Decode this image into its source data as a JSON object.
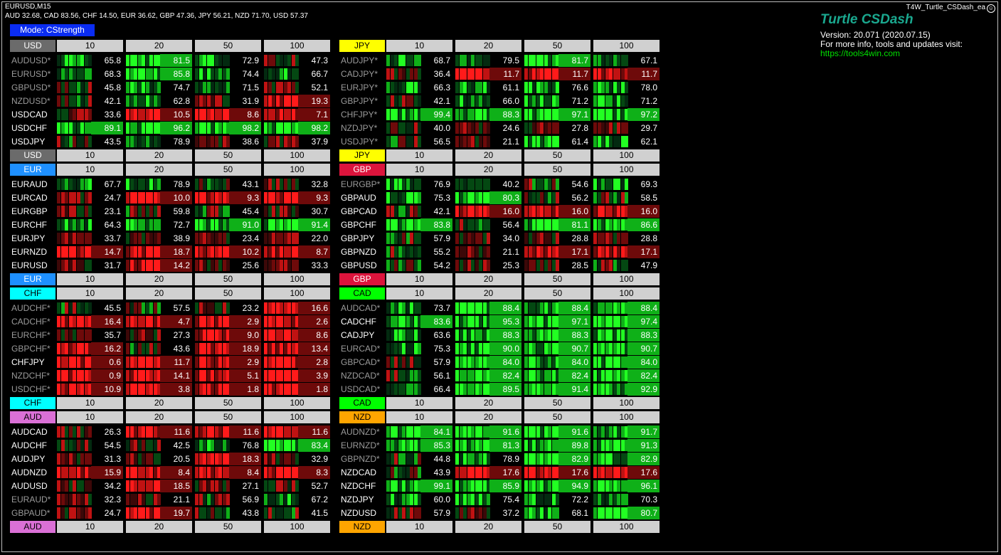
{
  "window": {
    "symbol_line": "EURUSD,M15",
    "strength_line": "AUD 32.68, CAD 83.56, CHF 14.50, EUR 36.62, GBP 47.36, JPY 56.21, NZD 71.70, USD 57.37",
    "ea_name": "T4W_Turtle_CSDash_ea"
  },
  "mode_button": {
    "label": "Mode: CStrength"
  },
  "brand": {
    "title": "Turtle CSDash",
    "version": "Version: 20.071 (2020.07.15)",
    "info": "For more info, tools and updates visit:",
    "link": "https://tools4win.com"
  },
  "colors": {
    "USD": "#6b6b6b",
    "EUR": "#1e90ff",
    "CHF": "#00ffff",
    "AUD": "#da70d6",
    "JPY": "#ffff00",
    "GBP": "#dc143c",
    "CAD": "#00ff00",
    "NZD": "#ffa500",
    "inactive_pair": "#9a9a9a",
    "active_pair": "#ffffff",
    "bright_green": "#22ff22",
    "green": "#0fb018",
    "dark_green": "#044812",
    "deepest_green": "#032a10",
    "bright_red": "#ff1a1a",
    "red": "#c01212",
    "dark_red": "#6e0a0a",
    "deepest_red": "#3c0808"
  },
  "timeframes": [
    "10",
    "20",
    "50",
    "100"
  ],
  "groups": [
    {
      "currency": "USD",
      "rows": [
        {
          "pair": "AUDUSD*",
          "values": [
            "65.8",
            "81.5",
            "72.9",
            "47.3"
          ]
        },
        {
          "pair": "EURUSD*",
          "values": [
            "68.3",
            "85.8",
            "74.4",
            "66.7"
          ]
        },
        {
          "pair": "GBPUSD*",
          "values": [
            "45.8",
            "74.7",
            "71.5",
            "52.1"
          ]
        },
        {
          "pair": "NZDUSD*",
          "values": [
            "42.1",
            "62.8",
            "31.9",
            "19.3"
          ]
        },
        {
          "pair": "USDCAD",
          "values": [
            "33.6",
            "10.5",
            "8.6",
            "7.1"
          ]
        },
        {
          "pair": "USDCHF",
          "values": [
            "89.1",
            "96.2",
            "98.2",
            "98.2"
          ]
        },
        {
          "pair": "USDJPY",
          "values": [
            "43.5",
            "78.9",
            "38.6",
            "37.9"
          ]
        }
      ]
    },
    {
      "currency": "JPY",
      "rows": [
        {
          "pair": "AUDJPY*",
          "values": [
            "68.7",
            "79.5",
            "81.7",
            "67.1"
          ]
        },
        {
          "pair": "CADJPY*",
          "values": [
            "36.4",
            "11.7",
            "11.7",
            "11.7"
          ]
        },
        {
          "pair": "EURJPY*",
          "values": [
            "66.3",
            "61.1",
            "76.6",
            "78.0"
          ]
        },
        {
          "pair": "GBPJPY*",
          "values": [
            "42.1",
            "66.0",
            "71.2",
            "71.2"
          ]
        },
        {
          "pair": "CHFJPY*",
          "values": [
            "99.4",
            "88.3",
            "97.1",
            "97.2"
          ]
        },
        {
          "pair": "NZDJPY*",
          "values": [
            "40.0",
            "24.6",
            "27.8",
            "29.7"
          ]
        },
        {
          "pair": "USDJPY*",
          "values": [
            "56.5",
            "21.1",
            "61.4",
            "62.1"
          ]
        }
      ]
    },
    {
      "currency": "EUR",
      "rows": [
        {
          "pair": "EURAUD",
          "values": [
            "67.7",
            "78.9",
            "43.1",
            "32.8"
          ]
        },
        {
          "pair": "EURCAD",
          "values": [
            "24.7",
            "10.0",
            "9.3",
            "9.3"
          ]
        },
        {
          "pair": "EURGBP",
          "values": [
            "23.1",
            "59.8",
            "45.4",
            "30.7"
          ]
        },
        {
          "pair": "EURCHF",
          "values": [
            "64.3",
            "72.7",
            "91.0",
            "91.4"
          ]
        },
        {
          "pair": "EURJPY",
          "values": [
            "33.7",
            "38.9",
            "23.4",
            "22.0"
          ]
        },
        {
          "pair": "EURNZD",
          "values": [
            "14.7",
            "18.7",
            "10.2",
            "8.7"
          ]
        },
        {
          "pair": "EURUSD",
          "values": [
            "31.7",
            "14.2",
            "25.6",
            "33.3"
          ]
        }
      ]
    },
    {
      "currency": "GBP",
      "rows": [
        {
          "pair": "EURGBP*",
          "values": [
            "76.9",
            "40.2",
            "54.6",
            "69.3"
          ]
        },
        {
          "pair": "GBPAUD",
          "values": [
            "75.3",
            "80.3",
            "56.2",
            "58.5"
          ]
        },
        {
          "pair": "GBPCAD",
          "values": [
            "42.1",
            "16.0",
            "16.0",
            "16.0"
          ]
        },
        {
          "pair": "GBPCHF",
          "values": [
            "83.8",
            "56.4",
            "81.1",
            "86.6"
          ]
        },
        {
          "pair": "GBPJPY",
          "values": [
            "57.9",
            "34.0",
            "28.8",
            "28.8"
          ]
        },
        {
          "pair": "GBPNZD",
          "values": [
            "55.2",
            "21.1",
            "17.1",
            "17.1"
          ]
        },
        {
          "pair": "GBPUSD",
          "values": [
            "54.2",
            "25.3",
            "28.5",
            "47.9"
          ]
        }
      ]
    },
    {
      "currency": "CHF",
      "rows": [
        {
          "pair": "AUDCHF*",
          "values": [
            "45.5",
            "57.5",
            "23.2",
            "16.6"
          ]
        },
        {
          "pair": "CADCHF*",
          "values": [
            "16.4",
            "4.7",
            "2.9",
            "2.6"
          ]
        },
        {
          "pair": "EURCHF*",
          "values": [
            "35.7",
            "27.3",
            "9.0",
            "8.6"
          ]
        },
        {
          "pair": "GBPCHF*",
          "values": [
            "16.2",
            "43.6",
            "18.9",
            "13.4"
          ]
        },
        {
          "pair": "CHFJPY",
          "values": [
            "0.6",
            "11.7",
            "2.9",
            "2.8"
          ]
        },
        {
          "pair": "NZDCHF*",
          "values": [
            "0.9",
            "14.1",
            "5.1",
            "3.9"
          ]
        },
        {
          "pair": "USDCHF*",
          "values": [
            "10.9",
            "3.8",
            "1.8",
            "1.8"
          ]
        }
      ]
    },
    {
      "currency": "CAD",
      "rows": [
        {
          "pair": "AUDCAD*",
          "values": [
            "73.7",
            "88.4",
            "88.4",
            "88.4"
          ]
        },
        {
          "pair": "CADCHF",
          "values": [
            "83.6",
            "95.3",
            "97.1",
            "97.4"
          ]
        },
        {
          "pair": "CADJPY",
          "values": [
            "63.6",
            "88.3",
            "88.3",
            "88.3"
          ]
        },
        {
          "pair": "EURCAD*",
          "values": [
            "75.3",
            "90.0",
            "90.7",
            "90.7"
          ]
        },
        {
          "pair": "GBPCAD*",
          "values": [
            "57.9",
            "84.0",
            "84.0",
            "84.0"
          ]
        },
        {
          "pair": "NZDCAD*",
          "values": [
            "56.1",
            "82.4",
            "82.4",
            "82.4"
          ]
        },
        {
          "pair": "USDCAD*",
          "values": [
            "66.4",
            "89.5",
            "91.4",
            "92.9"
          ]
        }
      ]
    },
    {
      "currency": "AUD",
      "rows": [
        {
          "pair": "AUDCAD",
          "values": [
            "26.3",
            "11.6",
            "11.6",
            "11.6"
          ]
        },
        {
          "pair": "AUDCHF",
          "values": [
            "54.5",
            "42.5",
            "76.8",
            "83.4"
          ]
        },
        {
          "pair": "AUDJPY",
          "values": [
            "31.3",
            "20.5",
            "18.3",
            "32.9"
          ]
        },
        {
          "pair": "AUDNZD",
          "values": [
            "15.9",
            "8.4",
            "8.4",
            "8.3"
          ]
        },
        {
          "pair": "AUDUSD",
          "values": [
            "34.2",
            "18.5",
            "27.1",
            "52.7"
          ]
        },
        {
          "pair": "EURAUD*",
          "values": [
            "32.3",
            "21.1",
            "56.9",
            "67.2"
          ]
        },
        {
          "pair": "GBPAUD*",
          "values": [
            "24.7",
            "19.7",
            "43.8",
            "41.5"
          ]
        }
      ]
    },
    {
      "currency": "NZD",
      "rows": [
        {
          "pair": "AUDNZD*",
          "values": [
            "84.1",
            "91.6",
            "91.6",
            "91.7"
          ]
        },
        {
          "pair": "EURNZD*",
          "values": [
            "85.3",
            "81.3",
            "89.8",
            "91.3"
          ]
        },
        {
          "pair": "GBPNZD*",
          "values": [
            "44.8",
            "78.9",
            "82.9",
            "82.9"
          ]
        },
        {
          "pair": "NZDCAD",
          "values": [
            "43.9",
            "17.6",
            "17.6",
            "17.6"
          ]
        },
        {
          "pair": "NZDCHF",
          "values": [
            "99.1",
            "85.9",
            "94.9",
            "96.1"
          ]
        },
        {
          "pair": "NZDJPY",
          "values": [
            "60.0",
            "75.4",
            "72.2",
            "70.3"
          ]
        },
        {
          "pair": "NZDUSD",
          "values": [
            "57.9",
            "37.2",
            "68.1",
            "80.7"
          ]
        }
      ]
    }
  ]
}
